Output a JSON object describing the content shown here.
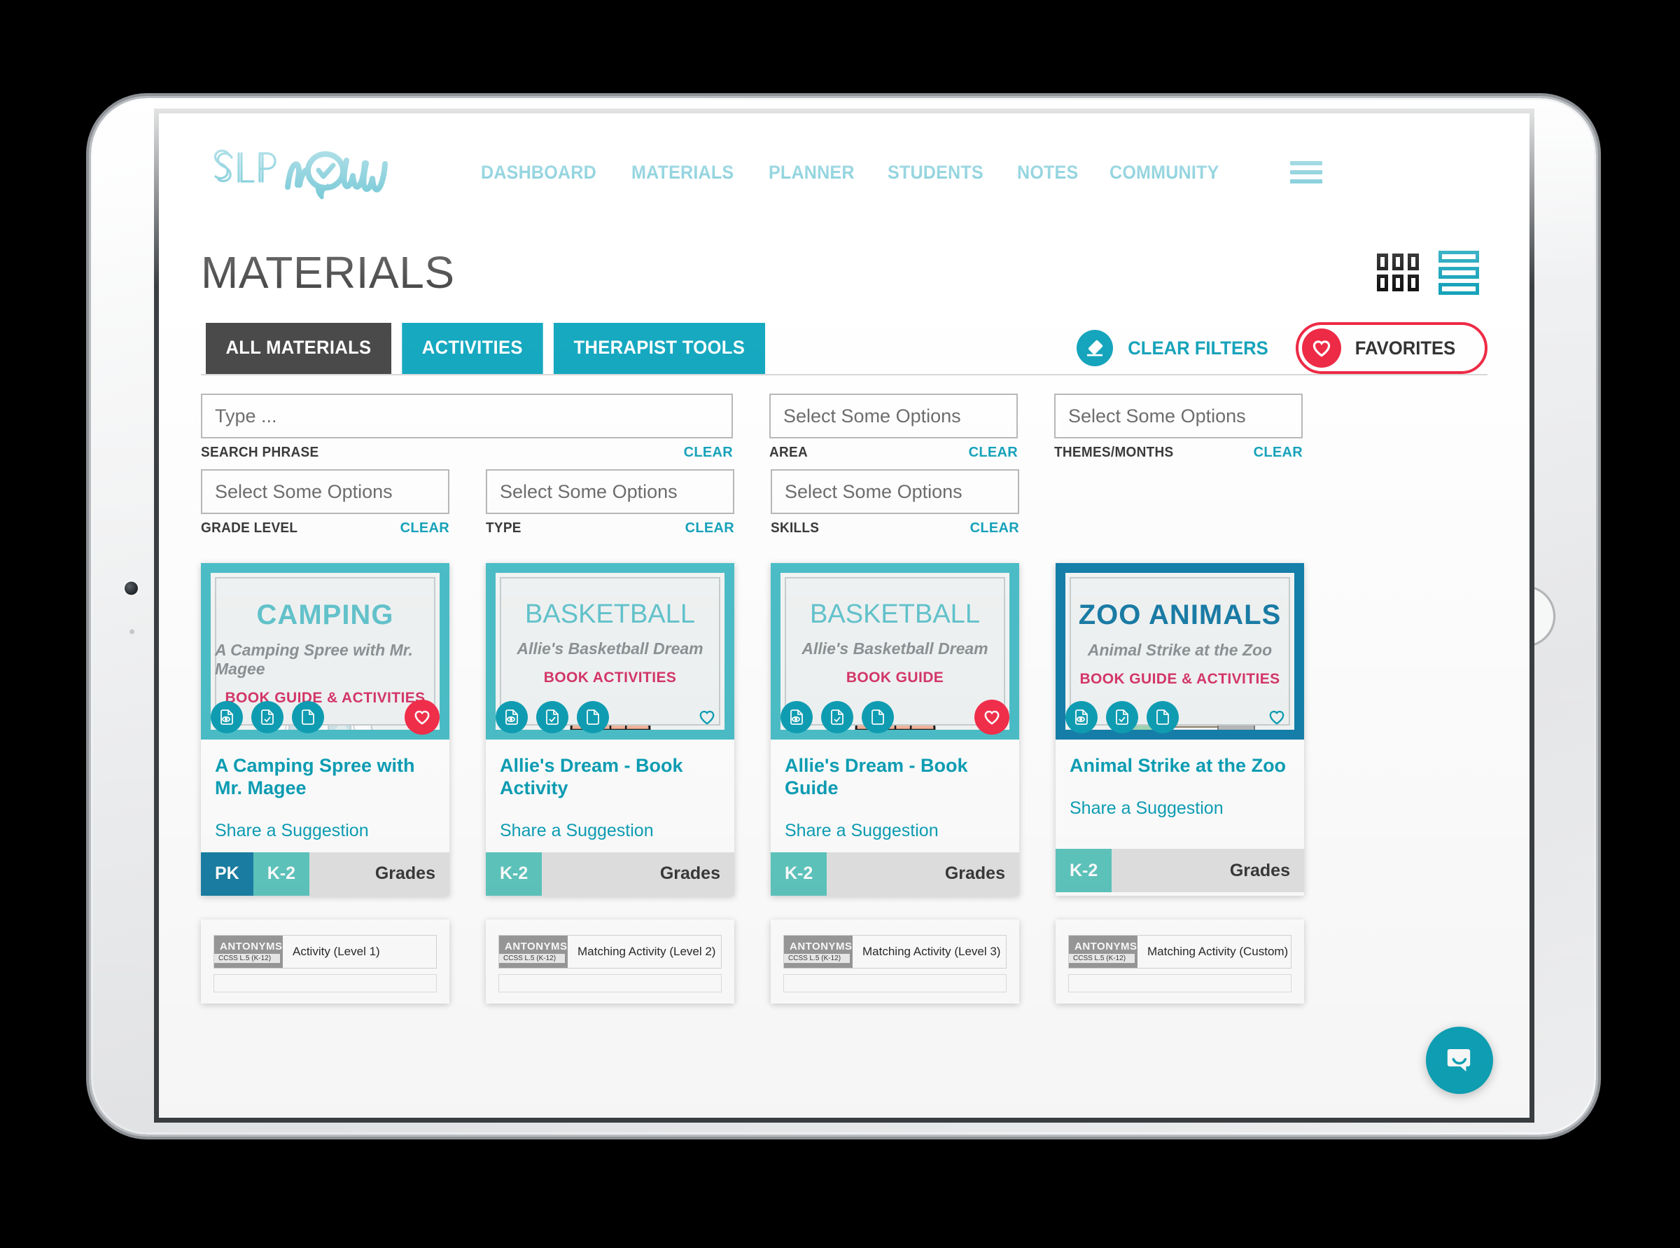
{
  "brand": {
    "logo_text": "SLP now",
    "accent": "#17a3bb",
    "red": "#ee2b46",
    "dark": "#4a4a4a"
  },
  "header": {
    "nav": [
      {
        "label": "DASHBOARD"
      },
      {
        "label": "MATERIALS"
      },
      {
        "label": "PLANNER"
      },
      {
        "label": "STUDENTS"
      },
      {
        "label": "NOTES"
      },
      {
        "label": "COMMUNITY"
      }
    ],
    "menu_icon": "hamburger-icon"
  },
  "page": {
    "title": "MATERIALS",
    "view_modes": [
      {
        "name": "grid-view-icon",
        "active": false
      },
      {
        "name": "list-view-icon",
        "active": true
      }
    ]
  },
  "tabs": [
    {
      "label": "ALL MATERIALS",
      "active": true
    },
    {
      "label": "ACTIVITIES",
      "active": false
    },
    {
      "label": "THERAPIST TOOLS",
      "active": false
    }
  ],
  "actions": {
    "clear_filters": "CLEAR FILTERS",
    "clear_filters_icon": "eraser-icon",
    "favorites": "FAVORITES",
    "favorites_icon": "heart-icon"
  },
  "filters": [
    {
      "label": "SEARCH PHRASE",
      "placeholder": "Type ...",
      "value": "",
      "clear": "CLEAR",
      "width": "wide"
    },
    {
      "label": "AREA",
      "placeholder": "Select Some Options",
      "value": "",
      "clear": "CLEAR",
      "width": "std"
    },
    {
      "label": "THEMES/MONTHS",
      "placeholder": "Select Some Options",
      "value": "",
      "clear": "CLEAR",
      "width": "std"
    },
    {
      "label": "GRADE LEVEL",
      "placeholder": "Select Some Options",
      "value": "",
      "clear": "CLEAR",
      "width": "std"
    },
    {
      "label": "TYPE",
      "placeholder": "Select Some Options",
      "value": "",
      "clear": "CLEAR",
      "width": "std"
    },
    {
      "label": "SKILLS",
      "placeholder": "Select Some Options",
      "value": "",
      "clear": "CLEAR",
      "width": "std"
    }
  ],
  "cards": [
    {
      "cover_title": "CAMPING",
      "cover_subtitle": "A Camping Spree with Mr. Magee",
      "cover_kicker": "BOOK GUIDE & ACTIVITIES",
      "cover_style": "teal",
      "title_style": "condensed",
      "art": "camper",
      "title": "A Camping Spree with Mr. Magee",
      "link": "Share a Suggestion",
      "grades": [
        "PK",
        "K-2"
      ],
      "grades_label": "Grades",
      "favorited": true,
      "action_icons": [
        "preview-icon",
        "document-check-icon",
        "document-icon"
      ]
    },
    {
      "cover_title": "BASKETBALL",
      "cover_subtitle": "Allie's Basketball Dream",
      "cover_kicker": "BOOK ACTIVITIES",
      "cover_style": "teal",
      "title_style": "plain",
      "art": "basketball",
      "title": "Allie's Dream - Book Activity",
      "link": "Share a Suggestion",
      "grades": [
        "K-2"
      ],
      "grades_label": "Grades",
      "favorited": false,
      "action_icons": [
        "preview-icon",
        "document-check-icon",
        "document-icon"
      ]
    },
    {
      "cover_title": "BASKETBALL",
      "cover_subtitle": "Allie's Basketball Dream",
      "cover_kicker": "BOOK GUIDE",
      "cover_style": "teal",
      "title_style": "plain",
      "art": "basketball",
      "title": "Allie's Dream - Book Guide",
      "link": "Share a Suggestion",
      "grades": [
        "K-2"
      ],
      "grades_label": "Grades",
      "favorited": true,
      "action_icons": [
        "preview-icon",
        "document-check-icon",
        "document-icon"
      ]
    },
    {
      "cover_title": "ZOO ANIMALS",
      "cover_subtitle": "Animal Strike at the Zoo",
      "cover_kicker": "BOOK GUIDE & ACTIVITIES",
      "cover_style": "blue",
      "title_style": "condensed",
      "art": "zoo",
      "title": "Animal Strike at the Zoo",
      "link": "Share a Suggestion",
      "grades": [
        "K-2"
      ],
      "grades_label": "Grades",
      "favorited": false,
      "action_icons": [
        "preview-icon",
        "document-check-icon",
        "document-icon"
      ]
    }
  ],
  "next_row_cards": [
    {
      "tag": "ANTONYMS",
      "code": "CCSS L.5 (K-12)",
      "title": "Activity (Level 1)"
    },
    {
      "tag": "ANTONYMS",
      "code": "CCSS L.5 (K-12)",
      "title": "Matching Activity (Level 2)"
    },
    {
      "tag": "ANTONYMS",
      "code": "CCSS L.5 (K-12)",
      "title": "Matching Activity (Level 3)"
    },
    {
      "tag": "ANTONYMS",
      "code": "CCSS L.5 (K-12)",
      "title": "Matching Activity (Custom)"
    }
  ],
  "chat": {
    "icon": "chat-bubble-icon"
  }
}
